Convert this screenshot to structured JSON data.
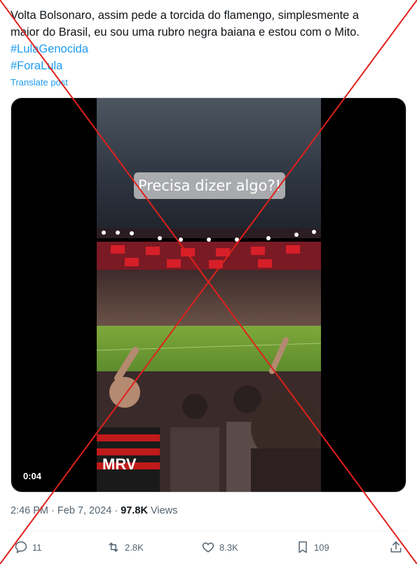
{
  "post": {
    "text_line1": "Volta Bolsonaro, assim pede a torcida do flamengo, simplesmente a",
    "text_line2": "maior do Brasil, eu sou uma rubro negra baiana e estou com o Mito.",
    "hashtags": [
      "#LulaGenocida",
      "#ForaLula"
    ],
    "translate_label": "Translate post"
  },
  "media": {
    "caption": "Precisa dizer algo?!",
    "shirt_text": "MRV",
    "duration": "0:04"
  },
  "meta": {
    "time": "2:46 PM",
    "separator": "·",
    "date": "Feb 7, 2024",
    "views_count": "97.8K",
    "views_label": "Views"
  },
  "actions": {
    "replies": "11",
    "reposts": "2.8K",
    "likes": "8.3K",
    "bookmarks": "109"
  },
  "colors": {
    "link": "#1d9bf0",
    "muted": "#536471",
    "cross": "#e0201c"
  }
}
